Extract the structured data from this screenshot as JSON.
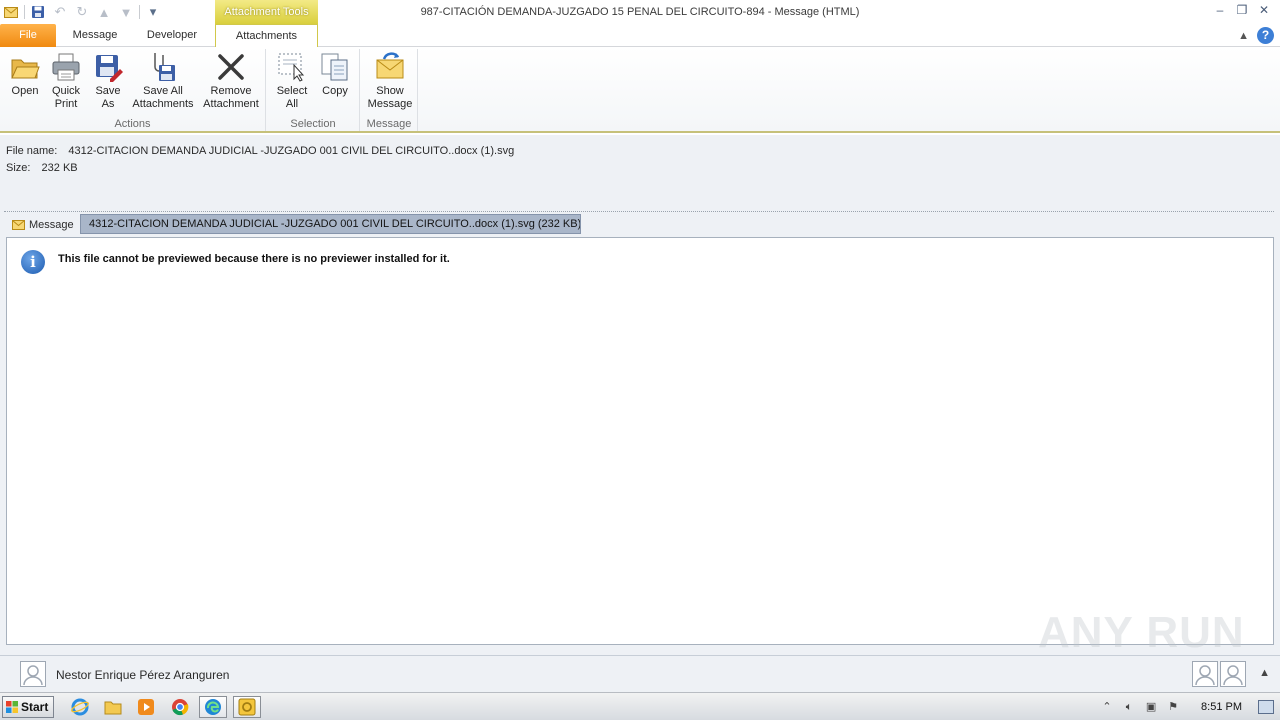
{
  "window": {
    "title": "987-CITACIÓN  DEMANDA-JUZGADO 15 PENAL DEL CIRCUITO-894  -  Message (HTML)",
    "context_tab_title": "Attachment Tools"
  },
  "tabs": [
    {
      "label": "File"
    },
    {
      "label": "Message"
    },
    {
      "label": "Developer"
    },
    {
      "label": "Attachments"
    }
  ],
  "ribbon": {
    "groups": {
      "actions": "Actions",
      "selection": "Selection",
      "message": "Message"
    },
    "buttons": {
      "open": "Open",
      "quick_print": "Quick Print",
      "save_as": "Save As",
      "save_all": "Save All Attachments",
      "remove": "Remove Attachment",
      "select_all": "Select All",
      "copy": "Copy",
      "show_message": "Show Message"
    }
  },
  "info": {
    "file_name_label": "File name:",
    "file_name": "4312-CITACION  DEMANDA JUDICIAL -JUZGADO 001 CIVIL DEL CIRCUITO..docx (1).svg",
    "size_label": "Size:",
    "size": "232 KB"
  },
  "strip": {
    "message_label": "Message",
    "attachment_label": "4312-CITACION  DEMANDA JUDICIAL -JUZGADO 001 CIVIL DEL CIRCUITO..docx (1).svg (232 KB)"
  },
  "preview": {
    "message": "This file cannot be previewed because there is no previewer installed for it."
  },
  "people": {
    "name": "Nestor Enrique Pérez Aranguren"
  },
  "watermark": "ANY RUN",
  "taskbar": {
    "start_label": "Start",
    "clock": "8:51 PM"
  },
  "colors": {
    "file_tab": "#f08a10",
    "context_tab": "#d9cf3d",
    "selected_attachment": "#a9b6c9",
    "info_icon": "#1c5bb0"
  }
}
